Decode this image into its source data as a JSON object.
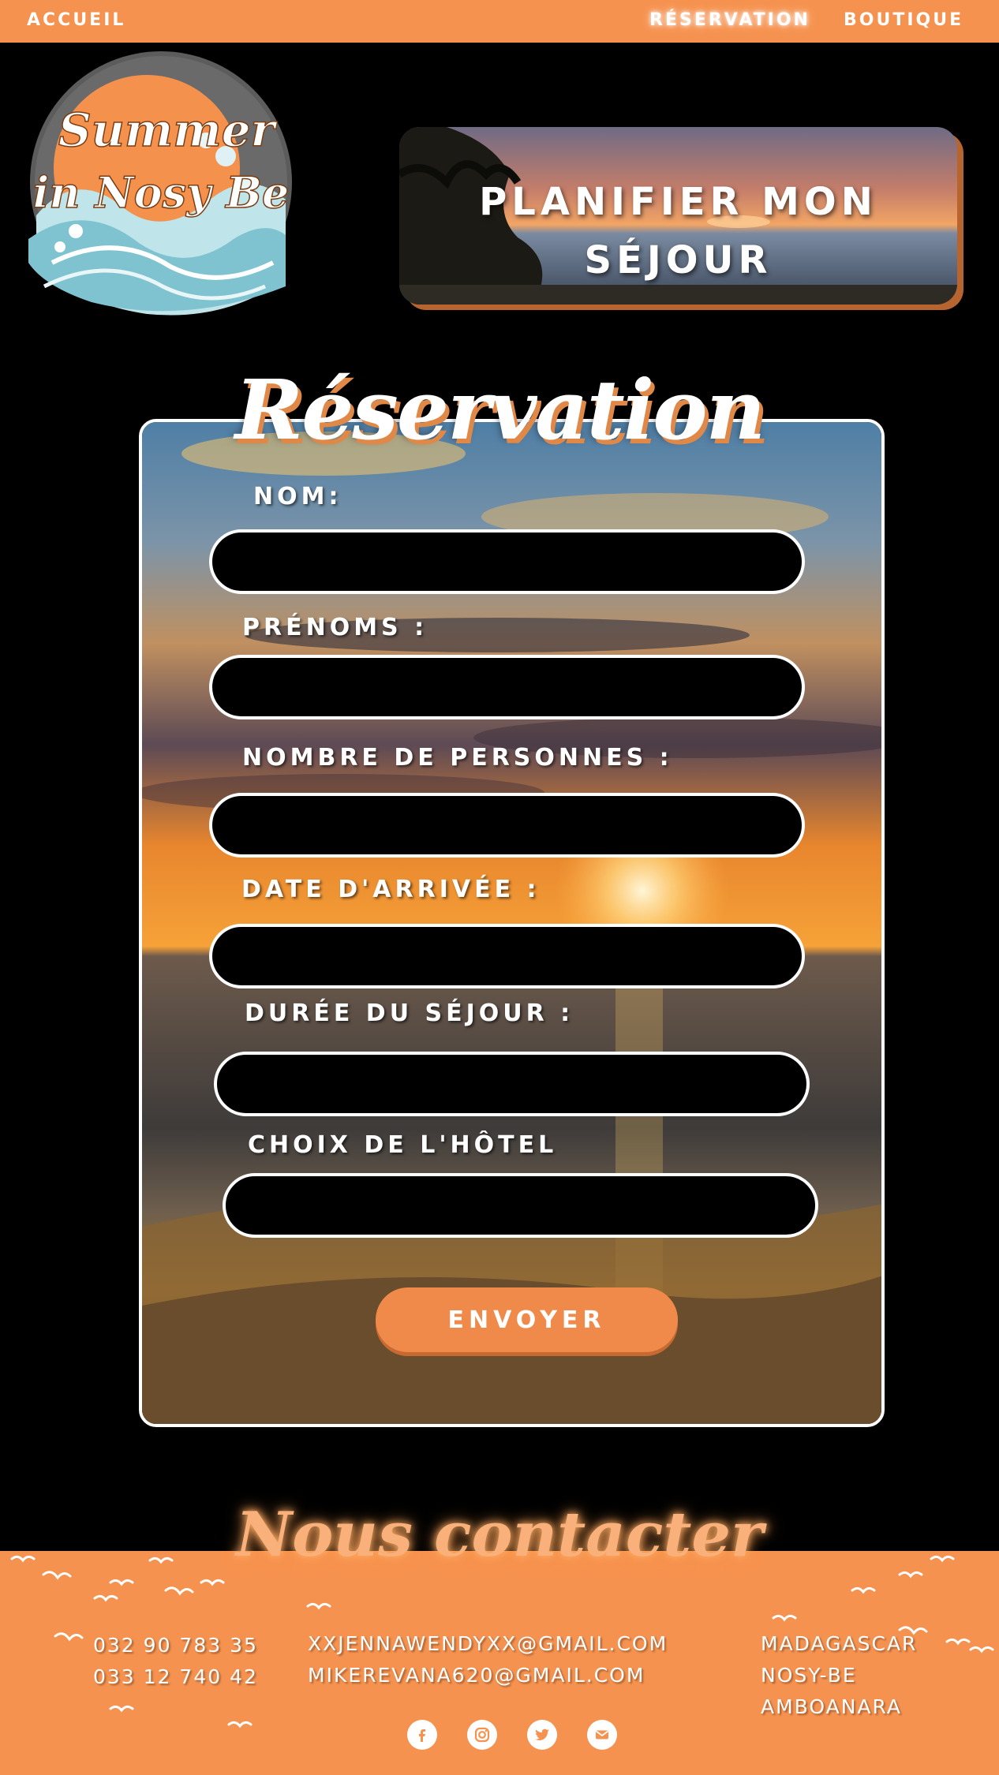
{
  "nav": {
    "home": "ACCUEIL",
    "reservation": "RÉSERVATION",
    "shop": "BOUTIQUE"
  },
  "logo": {
    "line1": "Summer",
    "line2": "in Nosy Be"
  },
  "plan": {
    "line1": "PLANIFIER MON",
    "line2": "SÉJOUR"
  },
  "form": {
    "title": "Réservation",
    "fields": [
      {
        "label": "NOM:",
        "value": ""
      },
      {
        "label": "PRÉNOMS :",
        "value": ""
      },
      {
        "label": "NOMBRE DE PERSONNES :",
        "value": ""
      },
      {
        "label": "DATE D'ARRIVÉE :",
        "value": ""
      },
      {
        "label": "DURÉE DU SÉJOUR :",
        "value": ""
      },
      {
        "label": "CHOIX DE L'HÔTEL",
        "value": ""
      }
    ],
    "submit": "ENVOYER"
  },
  "footer": {
    "title": "Nous contacter",
    "phones": [
      "032 90 783 35",
      "033 12 740 42"
    ],
    "emails": [
      "XXJENNAWENDYXX@GMAIL.COM",
      "MIKEREVANA620@GMAIL.COM"
    ],
    "address": [
      "MADAGASCAR",
      "NOSY-BE",
      "AMBOANARA"
    ],
    "socials": [
      "facebook-icon",
      "instagram-icon",
      "twitter-icon",
      "mail-icon"
    ]
  },
  "colors": {
    "accent": "#f6924f",
    "button": "#f08a4a",
    "background": "#000000"
  }
}
